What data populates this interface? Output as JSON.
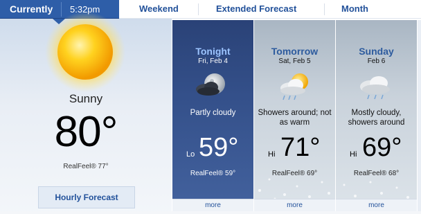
{
  "tabs": {
    "current_label": "Currently",
    "current_time": "5:32pm",
    "weekend": "Weekend",
    "extended": "Extended Forecast",
    "month": "Month"
  },
  "current": {
    "condition": "Sunny",
    "temp": "80°",
    "realfeel": "RealFeel® 77°",
    "hourly_button": "Hourly Forecast",
    "icon": "sun-icon"
  },
  "forecast": [
    {
      "day": "Tonight",
      "date": "Fri, Feb 4",
      "desc": "Partly cloudy",
      "hl": "Lo",
      "temp": "59°",
      "realfeel": "RealFeel® 59°",
      "more": "more",
      "icon": "moon-cloud-icon"
    },
    {
      "day": "Tomorrow",
      "date": "Sat, Feb 5",
      "desc": "Showers around; not as warm",
      "hl": "Hi",
      "temp": "71°",
      "realfeel": "RealFeel® 69°",
      "more": "more",
      "icon": "sun-cloud-rain-icon"
    },
    {
      "day": "Sunday",
      "date": "Feb 6",
      "desc": "Mostly cloudy, showers around",
      "hl": "Hi",
      "temp": "69°",
      "realfeel": "RealFeel® 68°",
      "more": "more",
      "icon": "cloud-rain-icon"
    }
  ],
  "colors": {
    "tab_active": "#2e5ea8",
    "link": "#22519a",
    "night_card": "#34508a",
    "day_card": "#c9d2db"
  }
}
